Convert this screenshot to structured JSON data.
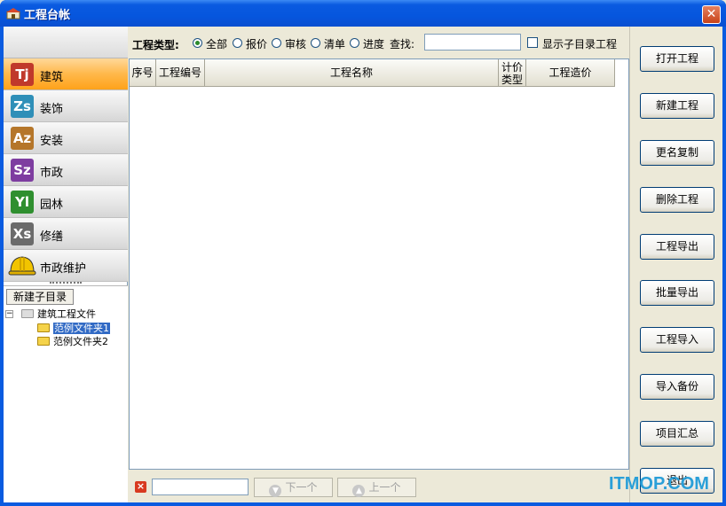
{
  "window": {
    "title": "工程台帐",
    "close_label": "✕"
  },
  "sidebar": {
    "categories": [
      {
        "code": "Tj",
        "label": "建筑",
        "color": "#c0392b",
        "active": true
      },
      {
        "code": "Zs",
        "label": "装饰",
        "color": "#2f8fb8"
      },
      {
        "code": "Az",
        "label": "安装",
        "color": "#b5762a"
      },
      {
        "code": "Sz",
        "label": "市政",
        "color": "#7e3da0"
      },
      {
        "code": "Yl",
        "label": "园林",
        "color": "#2f8f2f"
      },
      {
        "code": "Xs",
        "label": "修缮",
        "color": "#6b6b6b"
      },
      {
        "code": "",
        "label": "市政维护",
        "color": "#f2c400"
      }
    ],
    "new_subdir_label": "新建子目录",
    "tree": {
      "root": "建筑工程文件",
      "children": [
        "范例文件夹1",
        "范例文件夹2"
      ],
      "selected_index": 0
    }
  },
  "filter": {
    "type_label": "工程类型:",
    "options": [
      "全部",
      "报价",
      "审核",
      "清单",
      "进度"
    ],
    "selected": "全部",
    "search_label": "查找:",
    "search_value": "",
    "show_subdir_label": "显示子目录工程",
    "show_subdir_checked": false
  },
  "grid": {
    "columns": [
      "序号",
      "工程编号",
      "工程名称",
      "计价\n类型",
      "工程造价"
    ],
    "rows": []
  },
  "bottom": {
    "search_value": "",
    "next_label": "下一个",
    "prev_label": "上一个"
  },
  "actions": [
    "打开工程",
    "新建工程",
    "更名复制",
    "删除工程",
    "工程导出",
    "批量导出",
    "工程导入",
    "导入备份",
    "项目汇总",
    "退出"
  ],
  "watermark": "ITMOP.COM"
}
